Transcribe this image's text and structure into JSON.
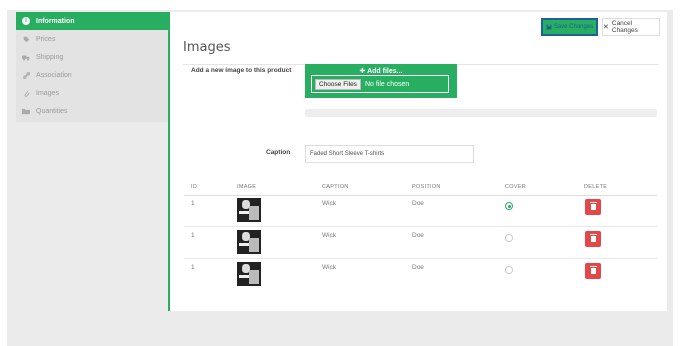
{
  "sidebar": {
    "items": [
      {
        "label": "Information",
        "icon": "info-icon",
        "active": true
      },
      {
        "label": "Prices",
        "icon": "tag-icon"
      },
      {
        "label": "Shipping",
        "icon": "truck-icon"
      },
      {
        "label": "Association",
        "icon": "link-icon"
      },
      {
        "label": "Images",
        "icon": "paperclip-icon"
      },
      {
        "label": "Quantities",
        "icon": "folder-icon"
      }
    ]
  },
  "toolbar": {
    "save_label": "Save Changes",
    "cancel_label": "Cancel Changes"
  },
  "images": {
    "title": "Images",
    "add_label": "Add a new image to this product",
    "add_files": "Add files...",
    "choose_files": "Choose Files",
    "no_file": "No file chosen",
    "caption_label": "Caption",
    "caption_value": "Faded Short Sleeve T-shirts"
  },
  "table": {
    "headers": [
      "ID",
      "IMAGE",
      "CAPTION",
      "POSITION",
      "COVER",
      "DELETE"
    ],
    "rows": [
      {
        "id": "1",
        "caption": "Wick",
        "position": "Doe",
        "cover": true
      },
      {
        "id": "1",
        "caption": "Wick",
        "position": "Doe",
        "cover": false
      },
      {
        "id": "1",
        "caption": "Wick",
        "position": "Doe",
        "cover": false
      }
    ]
  },
  "colors": {
    "accent": "#27ae60",
    "delete": "#e34747",
    "save_border": "#1e5f9c"
  }
}
